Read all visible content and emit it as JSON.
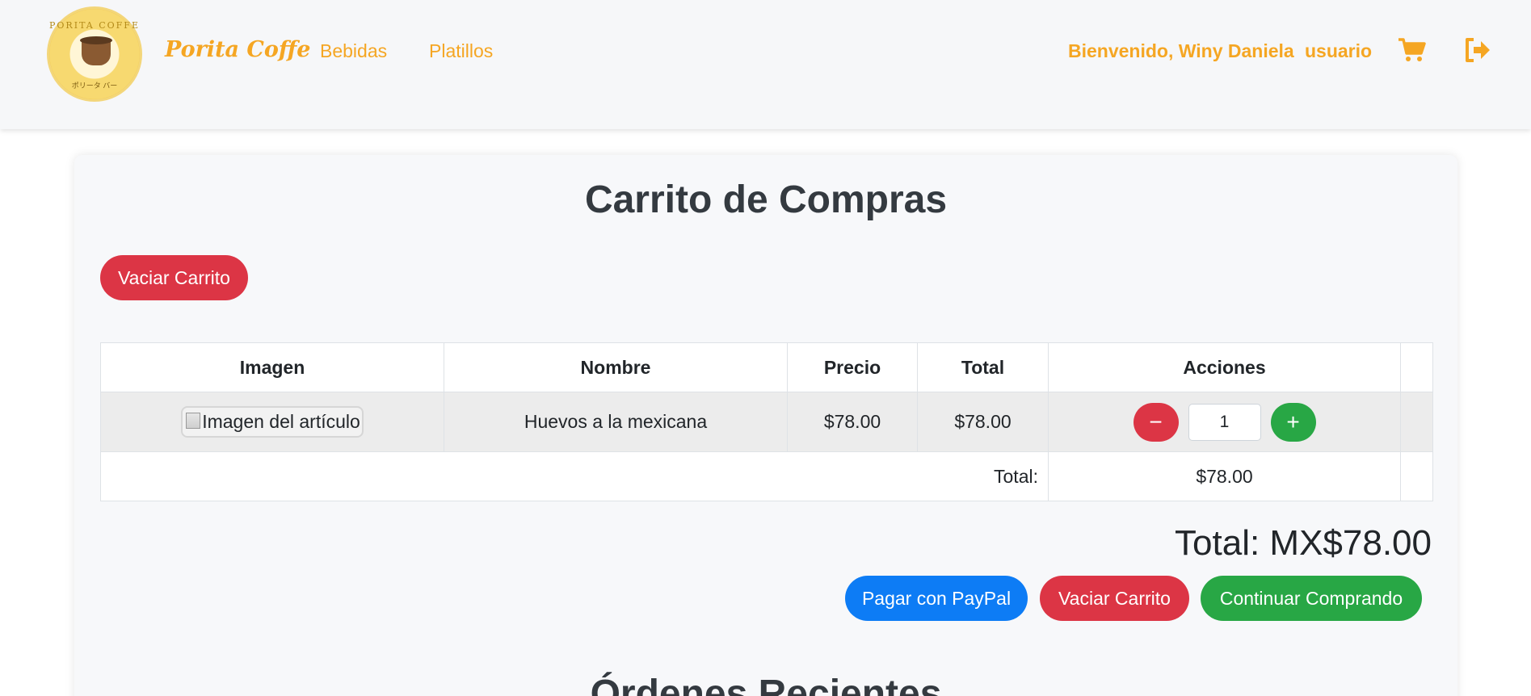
{
  "nav": {
    "brand": "Porita Coffe",
    "logo_text_top": "PORITA COFFE",
    "logo_text_bottom": "ポリータ バー",
    "links": [
      "Bebidas",
      "Platillos"
    ],
    "welcome": "Bienvenido, Winy Daniela",
    "user_label": "usuario",
    "icons": [
      "cart-icon",
      "logout-icon"
    ]
  },
  "cart": {
    "title": "Carrito de Compras",
    "clear_button": "Vaciar Carrito",
    "headers": [
      "Imagen",
      "Nombre",
      "Precio",
      "Total",
      "Acciones"
    ],
    "items": [
      {
        "image_alt": "Imagen del artículo",
        "name": "Huevos a la mexicana",
        "price": "$78.00",
        "total": "$78.00",
        "quantity": "1"
      }
    ],
    "total_label": "Total:",
    "total_value": "$78.00",
    "grand_total": "Total: MX$78.00",
    "buttons": {
      "paypal": "Pagar con PayPal",
      "clear": "Vaciar Carrito",
      "continue": "Continuar Comprando"
    },
    "minus_symbol": "−",
    "plus_symbol": "+"
  },
  "recent_orders": {
    "title": "Órdenes Recientes"
  },
  "colors": {
    "accent": "#f5a623",
    "danger": "#dc3545",
    "primary": "#0d7cf5",
    "success": "#28a745"
  }
}
